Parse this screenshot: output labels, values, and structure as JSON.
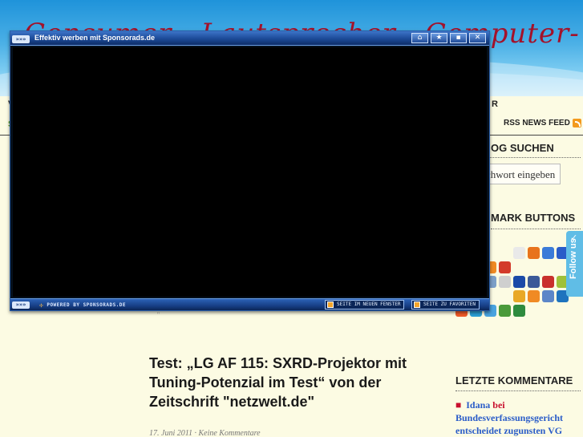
{
  "site": {
    "title": "Consumer-, Lautsprecher-, Computer- & Elektronik",
    "nav_left_initial": "V",
    "nav_right_initial": "R",
    "sub_initial": "S"
  },
  "sidebar": {
    "rss_label": "RSS NEWS FEED",
    "search_heading": "OG SUCHEN",
    "search_placeholder": "chwort eingeben",
    "bookmark_heading": "MARK BUTTONS",
    "follow_label": "Follow us",
    "recent_heading": "LETZTE KOMMENTARE",
    "recent_comments": [
      {
        "author": "Idana",
        "connector": "bei",
        "post": "Bundesverfassungsgericht entscheidet zugunsten VG"
      }
    ],
    "bookmark_colors": [
      "#f5a623",
      "#2a7bd3",
      "#46a63e",
      "#f2c21b",
      "#e9e9e9",
      "#e8731c",
      "#3b7bd8",
      "#2a5cc8",
      "#2a5cc8",
      "#5c9ee6",
      "#f08a24",
      "#d33a2a",
      "#2a7bd3",
      "#2e8b3e",
      "#888888",
      "#b3202f",
      "#7a1f1f",
      "#3b5ed1",
      "#7da0c8",
      "#cfcfcf",
      "#1b4aa8",
      "#3b5998",
      "#c9302c",
      "#9fc13a",
      "#f0a23a",
      "#4a9a3a",
      "#2a7bd3",
      "#f0a020",
      "#e9a827",
      "#f08a24",
      "#5b86c8",
      "#1e73be",
      "#f05a28",
      "#2a9fd6",
      "#49a3e0",
      "#4a9a3a",
      "#2e8b3e"
    ]
  },
  "post": {
    "title": "Test: „LG AF 115: SXRD-Projektor mit Tuning-Potenzial im Test“ von der Zeitschrift \"netzwelt.de\"",
    "meta": "17. Juni 2011 · Keine Kommentare"
  },
  "overlay": {
    "title": "Effektiv werben mit Sponsorads.de",
    "arrows": "»»»",
    "powered_by": "POWERED BY SPONSORADS.DE",
    "link_new_window": "SEITE IM NEUEN FENSTER",
    "link_favorites": "SEITE ZU FAVORITEN",
    "controls": [
      "home",
      "star",
      "minimize",
      "close"
    ]
  }
}
